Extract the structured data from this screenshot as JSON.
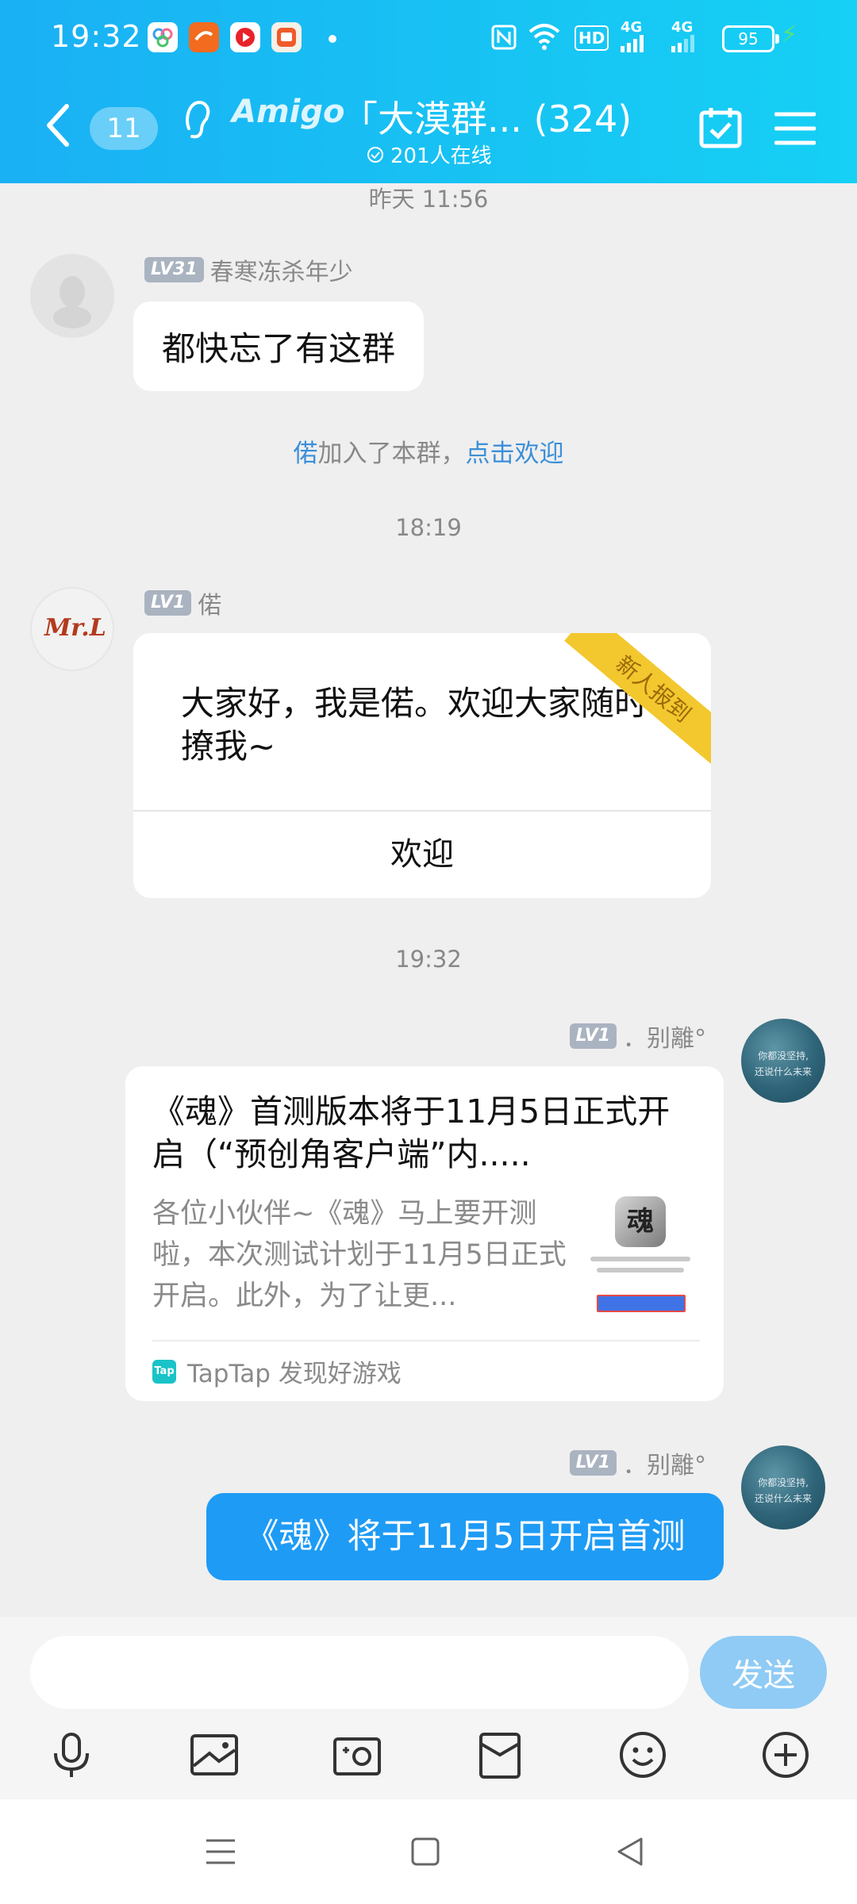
{
  "status_bar": {
    "time": "19:32",
    "apps": [
      "app-icon-1",
      "app-icon-2",
      "app-icon-3",
      "app-icon-4"
    ],
    "network": "4G",
    "hd": "HD",
    "battery": "95"
  },
  "header": {
    "unread_count": "11",
    "brand": "Amigo",
    "title": "「大漠群... (324)",
    "online": "201人在线"
  },
  "messages": {
    "ts1": "昨天 11:56",
    "msg1": {
      "level": "LV31",
      "sender": "春寒冻杀年少",
      "text": "都快忘了有这群"
    },
    "join": {
      "name": "偌",
      "middle": "加入了本群，",
      "action": "点击欢迎"
    },
    "ts2": "18:19",
    "msg2": {
      "level": "LV1",
      "sender": "偌",
      "avatar_text": "Mr.L",
      "text": "大家好，我是偌。欢迎大家随时撩我~",
      "ribbon": "新人报到",
      "button": "欢迎"
    },
    "ts3": "19:32",
    "msg3": {
      "level": "LV1",
      "sender": "．别離°",
      "avatar_text_line1": "你都没坚持,",
      "avatar_text_line2": "还说什么未来",
      "title": "《魂》首测版本将于11月5日正式开启（“预创角客户端”内.....",
      "desc": "各位小伙伴~《魂》马上要开测啦，本次测试计划于11月5日正式开启。此外，为了让更...",
      "thumb_glyph": "魂",
      "source": "TapTap 发现好游戏",
      "source_icon": "Tap"
    },
    "msg4": {
      "level": "LV1",
      "sender": "．别離°",
      "text": "《魂》将于11月5日开启首测"
    }
  },
  "input": {
    "placeholder": "",
    "value": "",
    "send": "发送"
  },
  "colors": {
    "header_blue": "#1ab0f4",
    "bubble_blue": "#1e9bf5",
    "link_blue": "#3b8fd9",
    "send_disabled": "#8fcbf5"
  }
}
